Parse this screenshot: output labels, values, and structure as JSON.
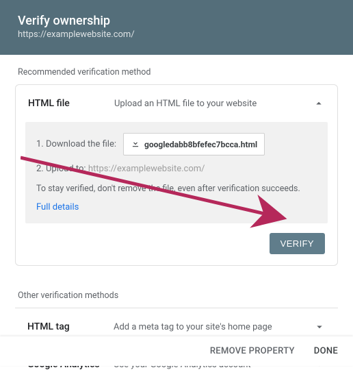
{
  "header": {
    "title": "Verify ownership",
    "url": "https://examplewebsite.com/"
  },
  "recommended": {
    "label": "Recommended verification method",
    "method": {
      "title": "HTML file",
      "desc": "Upload an HTML file to your website",
      "step1_label": "1. Download the file:",
      "download_filename": "googledabb8bfefec7bcca.html",
      "step2_label": "2. Upload to:",
      "step2_url": "https://examplewebsite.com/",
      "note": "To stay verified, don't remove the file, even after verification succeeds.",
      "full_details": "Full details",
      "verify_button": "VERIFY"
    }
  },
  "other": {
    "label": "Other verification methods",
    "methods": [
      {
        "title": "HTML tag",
        "desc": "Add a meta tag to your site's home page"
      },
      {
        "title": "Google Analytics",
        "desc": "Use your Google Analytics account"
      }
    ]
  },
  "footer": {
    "remove": "REMOVE PROPERTY",
    "done": "DONE"
  }
}
